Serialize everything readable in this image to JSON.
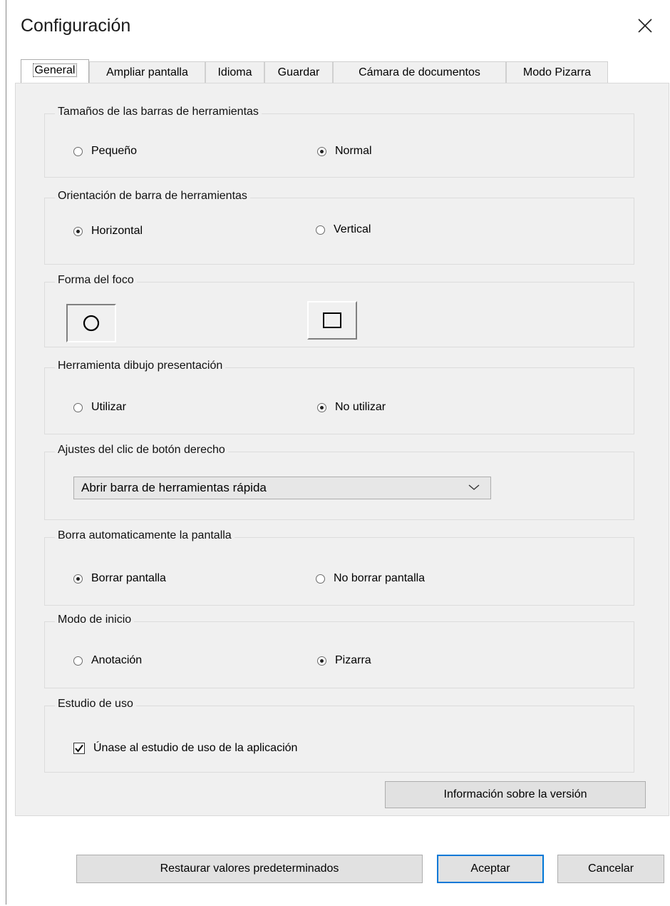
{
  "window": {
    "title": "Configuración"
  },
  "tabs": [
    {
      "label": "General"
    },
    {
      "label": "Ampliar pantalla"
    },
    {
      "label": "Idioma"
    },
    {
      "label": "Guardar"
    },
    {
      "label": "Cámara de documentos"
    },
    {
      "label": "Modo Pizarra"
    }
  ],
  "active_tab": "General",
  "groups": {
    "toolbar_size": {
      "legend": "Tamaños de las barras de herramientas",
      "options": [
        {
          "label": "Pequeño",
          "checked": false
        },
        {
          "label": "Normal",
          "checked": true
        }
      ]
    },
    "toolbar_orientation": {
      "legend": "Orientación de barra de herramientas",
      "options": [
        {
          "label": "Horizontal",
          "checked": true
        },
        {
          "label": "Vertical",
          "checked": false
        }
      ]
    },
    "focus_shape": {
      "legend": "Forma del foco",
      "options": [
        {
          "icon": "circle-icon",
          "selected": true
        },
        {
          "icon": "square-icon",
          "selected": false
        }
      ]
    },
    "drawing_tool": {
      "legend": "Herramienta dibujo presentación",
      "options": [
        {
          "label": "Utilizar",
          "checked": false
        },
        {
          "label": "No utilizar",
          "checked": true
        }
      ]
    },
    "right_click": {
      "legend": "Ajustes del clic de botón derecho",
      "selected": "Abrir barra de herramientas rápida"
    },
    "auto_clear": {
      "legend": "Borra automaticamente la pantalla",
      "options": [
        {
          "label": "Borrar pantalla",
          "checked": true
        },
        {
          "label": "No borrar pantalla",
          "checked": false
        }
      ]
    },
    "start_mode": {
      "legend": "Modo de inicio",
      "options": [
        {
          "label": "Anotación",
          "checked": false
        },
        {
          "label": "Pizarra",
          "checked": true
        }
      ]
    },
    "usage_study": {
      "legend": "Estudio de uso",
      "checkbox_label": "Únase al estudio de uso de la aplicación",
      "checked": true
    }
  },
  "buttons": {
    "version_info": "Información sobre la versión",
    "restore_defaults": "Restaurar valores predeterminados",
    "accept": "Aceptar",
    "cancel": "Cancelar"
  },
  "colors": {
    "accent": "#0078d7",
    "panel": "#f0f0f0"
  }
}
